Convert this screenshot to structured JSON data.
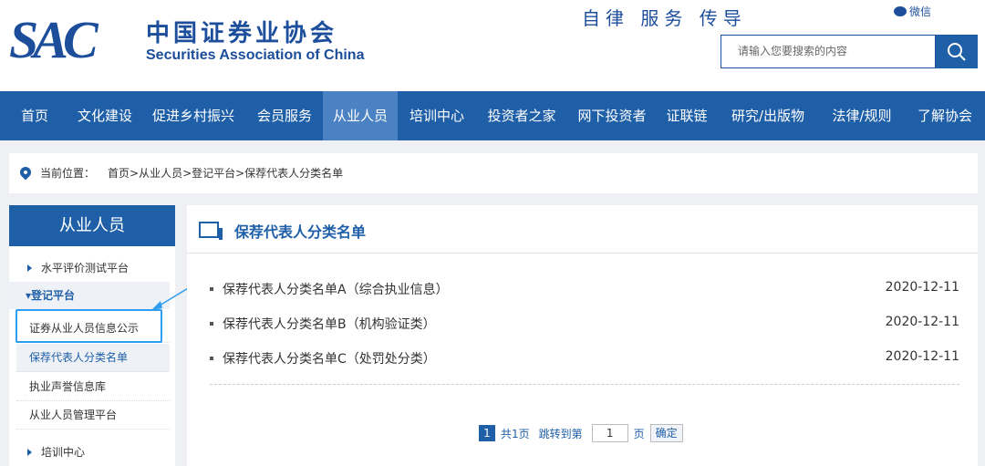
{
  "header": {
    "logo_mark": "SAC",
    "logo_cn": "中国证券业协会",
    "logo_en": "Securities Association of China",
    "motto": "自律 服务 传导",
    "wechat_label": "微信",
    "search_placeholder": "请输入您要搜索的内容"
  },
  "nav": {
    "items": [
      {
        "label": "首页"
      },
      {
        "label": "文化建设"
      },
      {
        "label": "促进乡村振兴"
      },
      {
        "label": "会员服务"
      },
      {
        "label": "从业人员"
      },
      {
        "label": "培训中心"
      },
      {
        "label": "投资者之家"
      },
      {
        "label": "网下投资者"
      },
      {
        "label": "证联链"
      },
      {
        "label": "研究/出版物"
      },
      {
        "label": "法律/规则"
      },
      {
        "label": "了解协会"
      }
    ],
    "active": "从业人员"
  },
  "breadcrumb": {
    "label": "当前位置：",
    "path": "首页>从业人员>登记平台>保荐代表人分类名单"
  },
  "sidebar": {
    "title": "从业人员",
    "items": [
      {
        "label": "水平评价测试平台"
      },
      {
        "label": "▾登记平台"
      },
      {
        "label": "证券从业人员信息公示"
      },
      {
        "label": "保荐代表人分类名单"
      },
      {
        "label": "执业声誉信息库"
      },
      {
        "label": "从业人员管理平台"
      },
      {
        "label": "培训中心"
      }
    ]
  },
  "main": {
    "title": "保荐代表人分类名单",
    "rows": [
      {
        "title": "保荐代表人分类名单A（综合执业信息）",
        "date": "2020-12-11"
      },
      {
        "title": "保荐代表人分类名单B（机构验证类）",
        "date": "2020-12-11"
      },
      {
        "title": "保荐代表人分类名单C（处罚处分类）",
        "date": "2020-12-11"
      }
    ],
    "pager": {
      "current": "1",
      "total": "共1页",
      "jump_label": "跳转到第",
      "input_value": "1",
      "page_suffix": "页",
      "confirm": "确定"
    }
  },
  "colors": {
    "brand": "#1f5fa8",
    "nav_active": "#4a82c3",
    "highlight": "#2d9ef0"
  }
}
